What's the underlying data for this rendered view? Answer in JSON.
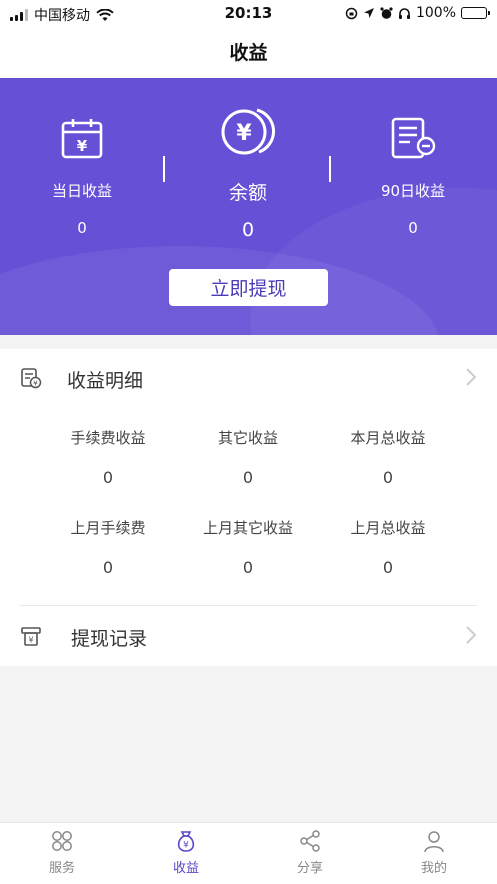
{
  "status_bar": {
    "carrier": "中国移动",
    "time": "20:13",
    "battery": "100%"
  },
  "navbar": {
    "title": "收益"
  },
  "summary": {
    "today_label": "当日收益",
    "today_value": "0",
    "balance_label": "余额",
    "balance_value": "0",
    "ninety_label": "90日收益",
    "ninety_value": "0",
    "withdraw_button": "立即提现"
  },
  "details": {
    "title": "收益明细",
    "stats": [
      {
        "label": "手续费收益",
        "value": "0"
      },
      {
        "label": "其它收益",
        "value": "0"
      },
      {
        "label": "本月总收益",
        "value": "0"
      },
      {
        "label": "上月手续费",
        "value": "0"
      },
      {
        "label": "上月其它收益",
        "value": "0"
      },
      {
        "label": "上月总收益",
        "value": "0"
      }
    ]
  },
  "withdraw_record": {
    "title": "提现记录"
  },
  "tabs": [
    {
      "label": "服务",
      "icon": "grid-icon",
      "active": false
    },
    {
      "label": "收益",
      "icon": "money-bag-icon",
      "active": true
    },
    {
      "label": "分享",
      "icon": "share-icon",
      "active": false
    },
    {
      "label": "我的",
      "icon": "person-icon",
      "active": false
    }
  ],
  "colors": {
    "accent": "#6650d6",
    "tab_active": "#5a45c8",
    "battery": "#2fbf3f"
  }
}
